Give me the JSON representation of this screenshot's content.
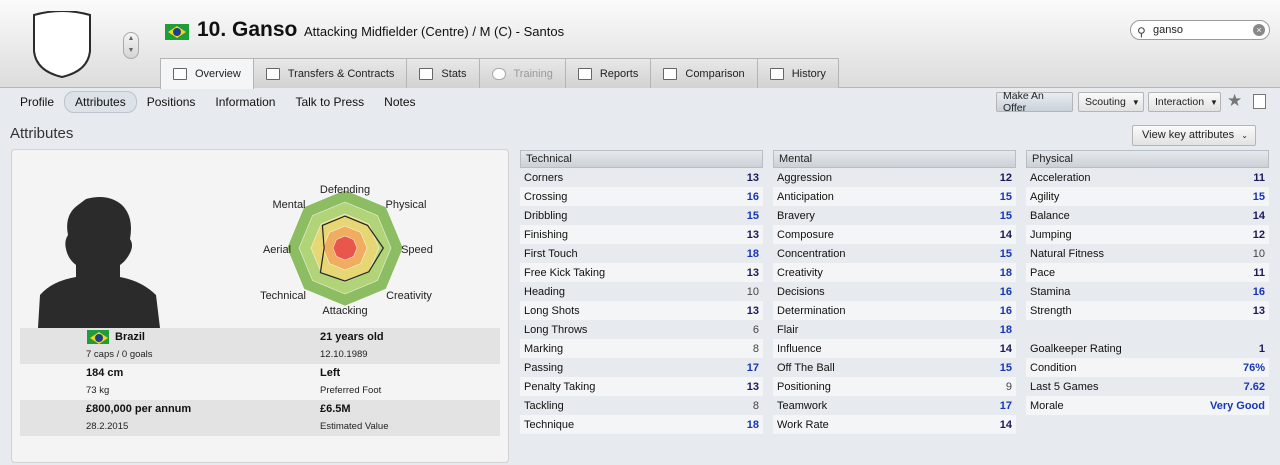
{
  "player": {
    "number_name": "10. Ganso",
    "position_club": "Attacking Midfielder (Centre) / M (C) - Santos"
  },
  "search": {
    "value": "ganso"
  },
  "tabs": [
    {
      "label": "Overview",
      "active": true
    },
    {
      "label": "Transfers & Contracts"
    },
    {
      "label": "Stats"
    },
    {
      "label": "Training",
      "disabled": true
    },
    {
      "label": "Reports"
    },
    {
      "label": "Comparison"
    },
    {
      "label": "History"
    }
  ],
  "subnav": [
    {
      "label": "Profile"
    },
    {
      "label": "Attributes",
      "active": true
    },
    {
      "label": "Positions"
    },
    {
      "label": "Information"
    },
    {
      "label": "Talk to Press"
    },
    {
      "label": "Notes"
    }
  ],
  "buttons": {
    "make_offer": "Make An Offer",
    "scouting": "Scouting",
    "interaction": "Interaction",
    "view_key": "View key attributes"
  },
  "page_title": "Attributes",
  "radar": {
    "labels": [
      "Defending",
      "Physical",
      "Speed",
      "Creativity",
      "Attacking",
      "Technical",
      "Aerial",
      "Mental"
    ],
    "values": [
      0.55,
      0.55,
      0.66,
      0.58,
      0.57,
      0.6,
      0.36,
      0.55
    ]
  },
  "info": {
    "nation": "Brazil",
    "caps": "7 caps / 0 goals",
    "age": "21 years old",
    "dob": "12.10.1989",
    "height": "184 cm",
    "weight": "73 kg",
    "foot": "Left",
    "foot_label": "Preferred Foot",
    "wage": "£800,000 per annum",
    "contract": "28.2.2015",
    "value": "£6.5M",
    "value_label": "Estimated Value"
  },
  "technical": {
    "title": "Technical",
    "rows": [
      {
        "name": "Corners",
        "value": "13"
      },
      {
        "name": "Crossing",
        "value": "16"
      },
      {
        "name": "Dribbling",
        "value": "15"
      },
      {
        "name": "Finishing",
        "value": "13"
      },
      {
        "name": "First Touch",
        "value": "18"
      },
      {
        "name": "Free Kick Taking",
        "value": "13"
      },
      {
        "name": "Heading",
        "value": "10"
      },
      {
        "name": "Long Shots",
        "value": "13"
      },
      {
        "name": "Long Throws",
        "value": "6"
      },
      {
        "name": "Marking",
        "value": "8"
      },
      {
        "name": "Passing",
        "value": "17"
      },
      {
        "name": "Penalty Taking",
        "value": "13"
      },
      {
        "name": "Tackling",
        "value": "8"
      },
      {
        "name": "Technique",
        "value": "18"
      }
    ]
  },
  "mental": {
    "title": "Mental",
    "rows": [
      {
        "name": "Aggression",
        "value": "12"
      },
      {
        "name": "Anticipation",
        "value": "15"
      },
      {
        "name": "Bravery",
        "value": "15"
      },
      {
        "name": "Composure",
        "value": "14"
      },
      {
        "name": "Concentration",
        "value": "15"
      },
      {
        "name": "Creativity",
        "value": "18"
      },
      {
        "name": "Decisions",
        "value": "16"
      },
      {
        "name": "Determination",
        "value": "16"
      },
      {
        "name": "Flair",
        "value": "18"
      },
      {
        "name": "Influence",
        "value": "14"
      },
      {
        "name": "Off The Ball",
        "value": "15"
      },
      {
        "name": "Positioning",
        "value": "9"
      },
      {
        "name": "Teamwork",
        "value": "17"
      },
      {
        "name": "Work Rate",
        "value": "14"
      }
    ]
  },
  "physical": {
    "title": "Physical",
    "rows": [
      {
        "name": "Acceleration",
        "value": "11"
      },
      {
        "name": "Agility",
        "value": "15"
      },
      {
        "name": "Balance",
        "value": "14"
      },
      {
        "name": "Jumping",
        "value": "12"
      },
      {
        "name": "Natural Fitness",
        "value": "10"
      },
      {
        "name": "Pace",
        "value": "11"
      },
      {
        "name": "Stamina",
        "value": "16"
      },
      {
        "name": "Strength",
        "value": "13"
      }
    ]
  },
  "extra": [
    {
      "name": "Goalkeeper Rating",
      "value": "1"
    },
    {
      "name": "Condition",
      "value": "76%"
    },
    {
      "name": "Last 5 Games",
      "value": "7.62"
    },
    {
      "name": "Morale",
      "value": "Very Good"
    }
  ]
}
